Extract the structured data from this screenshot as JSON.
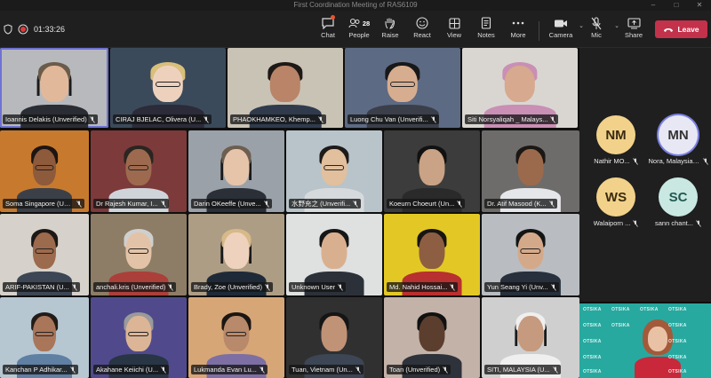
{
  "window": {
    "title": "First Coordination Meeting of RAS6109",
    "controls": [
      "–",
      "□",
      "✕"
    ]
  },
  "toolbar": {
    "timer": "01:33:26",
    "chat": "Chat",
    "people": "People",
    "people_count": "28",
    "raise": "Raise",
    "react": "React",
    "view": "View",
    "notes": "Notes",
    "more": "More",
    "camera": "Camera",
    "mic": "Mic",
    "share": "Share",
    "leave": "Leave"
  },
  "colors": {
    "leave": "#c4314b",
    "active_speaker": "#6f73d2",
    "presenter_bg": "#27a9a0"
  },
  "participants": [
    {
      "name": "Ioannis Delakis (Unverified)"
    },
    {
      "name": "CIRAJ BJELAC, Olivera (U..."
    },
    {
      "name": "PHAOKHAMKEO, Khemp..."
    },
    {
      "name": "Luong Chu Van (Unverifi..."
    },
    {
      "name": "Siti Norsyaliqah _ Malays..."
    },
    {
      "name": "Soma Singapore (Unve..."
    },
    {
      "name": "Dr Rajesh Kumar, I..."
    },
    {
      "name": "Darin OKeeffe (Unve..."
    },
    {
      "name": "水野充之 (Unverifi..."
    },
    {
      "name": "Koeurn Choeurt (Un..."
    },
    {
      "name": "Dr. Atif Masood (K..."
    },
    {
      "name": "ARIF-PAKISTAN (U..."
    },
    {
      "name": "anchali.kris (Unverified)"
    },
    {
      "name": "Brady, Zoe (Unverified)"
    },
    {
      "name": "Unknown User"
    },
    {
      "name": "Md. Nahid Hossai..."
    },
    {
      "name": "Yun Seang Yi (Unv..."
    },
    {
      "name": "Kanchan P Adhikar..."
    },
    {
      "name": "Akahane Keiichi (U..."
    },
    {
      "name": "Lukmanda Evan Lu..."
    },
    {
      "name": "Tuan, Vietnam (Un..."
    },
    {
      "name": "Toan (Unverified)"
    },
    {
      "name": "SITI, MALAYSIA (U..."
    }
  ],
  "avatar_participants": [
    {
      "initials": "NM",
      "name": "Nathir MO..."
    },
    {
      "initials": "MN",
      "name": "Nora, Malaysia ..."
    },
    {
      "initials": "WS",
      "name": "Walaiporn ..."
    },
    {
      "initials": "SC",
      "name": "sann chant..."
    }
  ],
  "presenter": {
    "logo_text": "OTSIKA"
  }
}
